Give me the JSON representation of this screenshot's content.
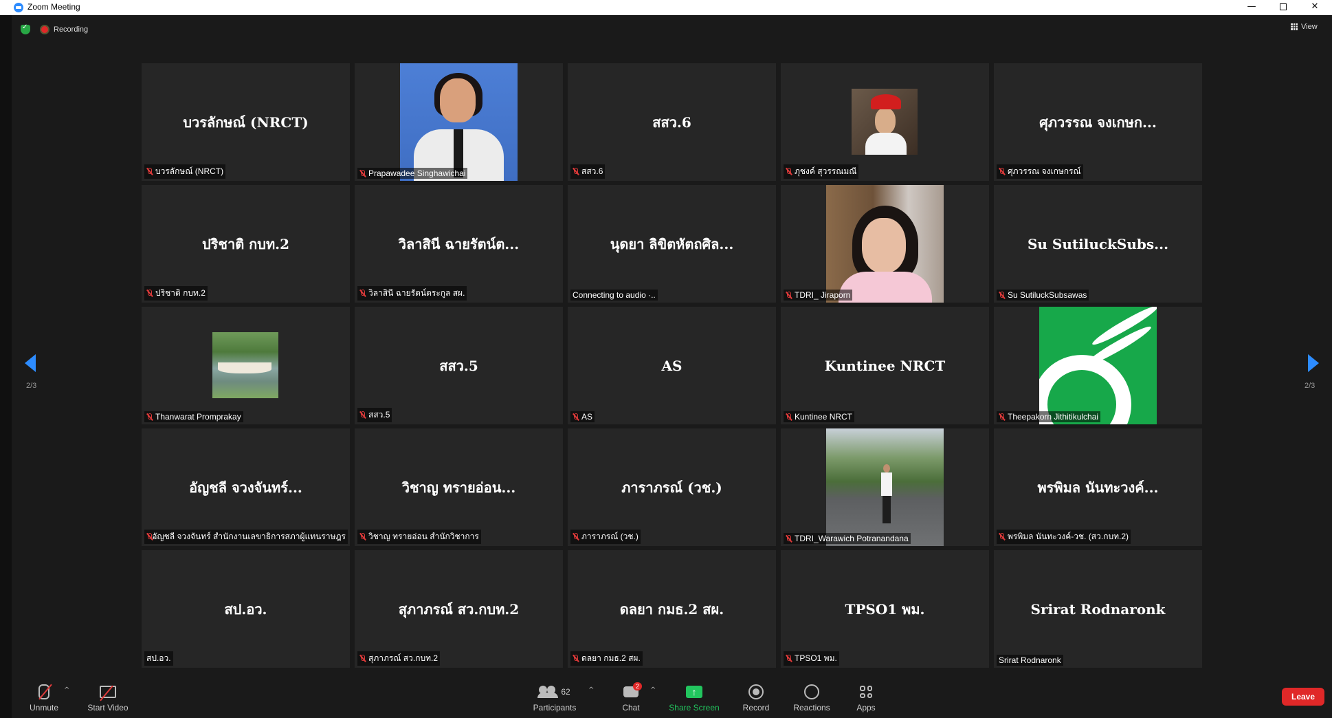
{
  "window": {
    "title": "Zoom Meeting",
    "min_icon": "minimize-icon",
    "max_icon": "restore-icon",
    "close_icon": "close-icon"
  },
  "status": {
    "recording_label": "Recording",
    "view_label": "View"
  },
  "pagination": {
    "left": "2/3",
    "right": "2/3"
  },
  "tiles": [
    {
      "center": "บวรลักษณ์ (NRCT)",
      "label": "บวรลักษณ์ (NRCT)",
      "muted": true
    },
    {
      "center": "",
      "label": "Prapawadee Singhawichai",
      "muted": true,
      "photo": "portrait"
    },
    {
      "center": "สสว.6",
      "label": "สสว.6",
      "muted": true
    },
    {
      "center": "",
      "label": "ภุชงค์ สุวรรณมณี",
      "muted": true,
      "photo": "santa"
    },
    {
      "center": "ศุภวรรณ จงเกษก...",
      "label": "ศุภวรรณ จงเกษกรณ์",
      "muted": true
    },
    {
      "center": "ปริชาติ กบท.2",
      "label": "ปริชาติ กบท.2",
      "muted": true
    },
    {
      "center": "วิลาสินี ฉายรัตน์ต...",
      "label": "วิลาสินี ฉายรัตน์ตระกูล สผ.",
      "muted": true
    },
    {
      "center": "นุดยา ลิขิตหัตถศิล...",
      "label": "Connecting to audio ·..",
      "muted": false
    },
    {
      "center": "",
      "label": "TDRI_ Jiraporn",
      "muted": true,
      "photo": "woman2"
    },
    {
      "center": "Su  SutiluckSubs...",
      "label": "Su SutiluckSubsawas",
      "muted": true
    },
    {
      "center": "",
      "label": "Thanwarat Promprakay",
      "muted": true,
      "photo": "lake"
    },
    {
      "center": "สสว.5",
      "label": "สสว.5",
      "muted": true
    },
    {
      "center": "AS",
      "label": "AS",
      "muted": true
    },
    {
      "center": "Kuntinee NRCT",
      "label": "Kuntinee NRCT",
      "muted": true
    },
    {
      "center": "",
      "label": "Theepakorn Jithitikulchai",
      "muted": true,
      "photo": "green"
    },
    {
      "center": "อัญชลี  จวงจันทร์...",
      "label": "อัญชลี  จวงจันทร์  สำนักงานเลขาธิการสภาผู้แทนราษฎร",
      "muted": true
    },
    {
      "center": "วิชาญ ทรายอ่อน...",
      "label": "วิชาญ ทรายอ่อน สำนักวิชาการ",
      "muted": true
    },
    {
      "center": "ภาราภรณ์ (วช.)",
      "label": "ภาราภรณ์ (วช.)",
      "muted": true
    },
    {
      "center": "",
      "label": "TDRI_Warawich Potranandana",
      "muted": true,
      "photo": "street"
    },
    {
      "center": "พรพิมล นันทะวงค์...",
      "label": "พรพิมล นันทะวงค์-วช. (สว.กบท.2)",
      "muted": true
    },
    {
      "center": "สป.อว.",
      "label": "สป.อว.",
      "muted": false
    },
    {
      "center": "สุภาภรณ์ สว.กบท.2",
      "label": "สุภาภรณ์ สว.กบท.2",
      "muted": true
    },
    {
      "center": "ดลยา กมธ.2 สผ.",
      "label": "ดลยา กมธ.2 สผ.",
      "muted": true
    },
    {
      "center": "TPSO1 พม.",
      "label": "TPSO1 พม.",
      "muted": true
    },
    {
      "center": "Srirat Rodnaronk",
      "label": "Srirat Rodnaronk",
      "muted": false
    }
  ],
  "toolbar": {
    "unmute": "Unmute",
    "start_video": "Start Video",
    "participants": "Participants",
    "participants_count": "62",
    "chat": "Chat",
    "chat_badge": "2",
    "share": "Share Screen",
    "record": "Record",
    "reactions": "Reactions",
    "apps": "Apps",
    "leave": "Leave"
  },
  "colors": {
    "accent": "#2D8CFF",
    "leave": "#E02828",
    "share": "#22C55E",
    "tile_bg": "#262626"
  }
}
